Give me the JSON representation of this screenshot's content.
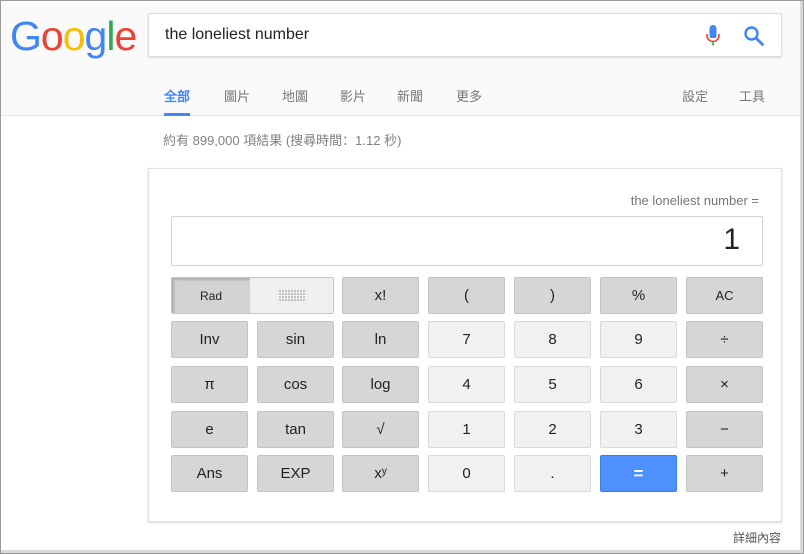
{
  "logo": {
    "letters": [
      "G",
      "o",
      "o",
      "g",
      "l",
      "e"
    ],
    "colors": [
      "#4285f4",
      "#ea4335",
      "#fbbc05",
      "#4285f4",
      "#34a853",
      "#ea4335"
    ]
  },
  "search": {
    "query": "the loneliest number",
    "mic_color": "#4285f4",
    "search_icon_color": "#4285f4"
  },
  "tabs": {
    "all": "全部",
    "images": "圖片",
    "maps": "地圖",
    "videos": "影片",
    "news": "新聞",
    "more": "更多",
    "settings": "設定",
    "tools": "工具"
  },
  "stats": "約有 899,000 項結果 (搜尋時間：1.12 秒)",
  "calculator": {
    "expression": "the loneliest number =",
    "display": "1",
    "rad_label": "Rad",
    "keys": {
      "fact": "x!",
      "lparen": "(",
      "rparen": ")",
      "percent": "%",
      "ac": "AC",
      "inv": "Inv",
      "sin": "sin",
      "ln": "ln",
      "d7": "7",
      "d8": "8",
      "d9": "9",
      "div": "÷",
      "pi": "π",
      "cos": "cos",
      "log": "log",
      "d4": "4",
      "d5": "5",
      "d6": "6",
      "mul": "×",
      "e": "e",
      "tan": "tan",
      "sqrt": "√",
      "d1": "1",
      "d2": "2",
      "d3": "3",
      "sub": "−",
      "ans": "Ans",
      "exp": "EXP",
      "pow": "xʸ",
      "d0": "0",
      "dot": ".",
      "eq": "=",
      "add": "+"
    }
  },
  "more_link": "詳細內容"
}
